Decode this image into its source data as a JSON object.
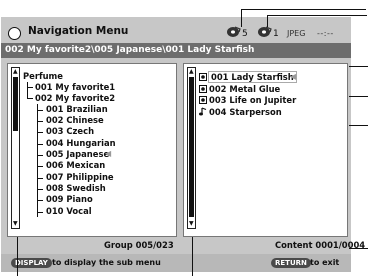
{
  "header": {
    "title": "Navigation Menu",
    "disc_icon_1": "disc-icon",
    "count_1": "5",
    "disc_icon_2": "disc-icon",
    "count_2": "1",
    "type": "JPEG",
    "time": "--:--"
  },
  "path": "002 My favorite2\\005 Japanese\\001 Lady Starfish",
  "tree": {
    "root": "Perfume",
    "level1": [
      "001 My favorite1",
      "002 My favorite2"
    ],
    "level2": [
      "001 Brazilian",
      "002 Chinese",
      "003 Czech",
      "004 Hungarian",
      "005 Japanese",
      "006 Mexican",
      "007 Philippine",
      "008 Swedish",
      "009 Piano",
      "010 Vocal"
    ],
    "selected_index": 4
  },
  "files": [
    {
      "name": "001 Lady Starfish",
      "icon": "picture-icon",
      "selected": true
    },
    {
      "name": "002 Metal Glue",
      "icon": "picture-icon",
      "selected": false
    },
    {
      "name": "003 Life on Jupiter",
      "icon": "picture-icon",
      "selected": false
    },
    {
      "name": "004 Starperson",
      "icon": "music-note-icon",
      "selected": false
    }
  ],
  "status": {
    "group": "Group 005/023",
    "content": "Content 0001/0004"
  },
  "footer": {
    "display_key": "DISPLAY",
    "display_text": "to display the sub menu",
    "return_key": "RETURN",
    "return_text": "to exit"
  }
}
